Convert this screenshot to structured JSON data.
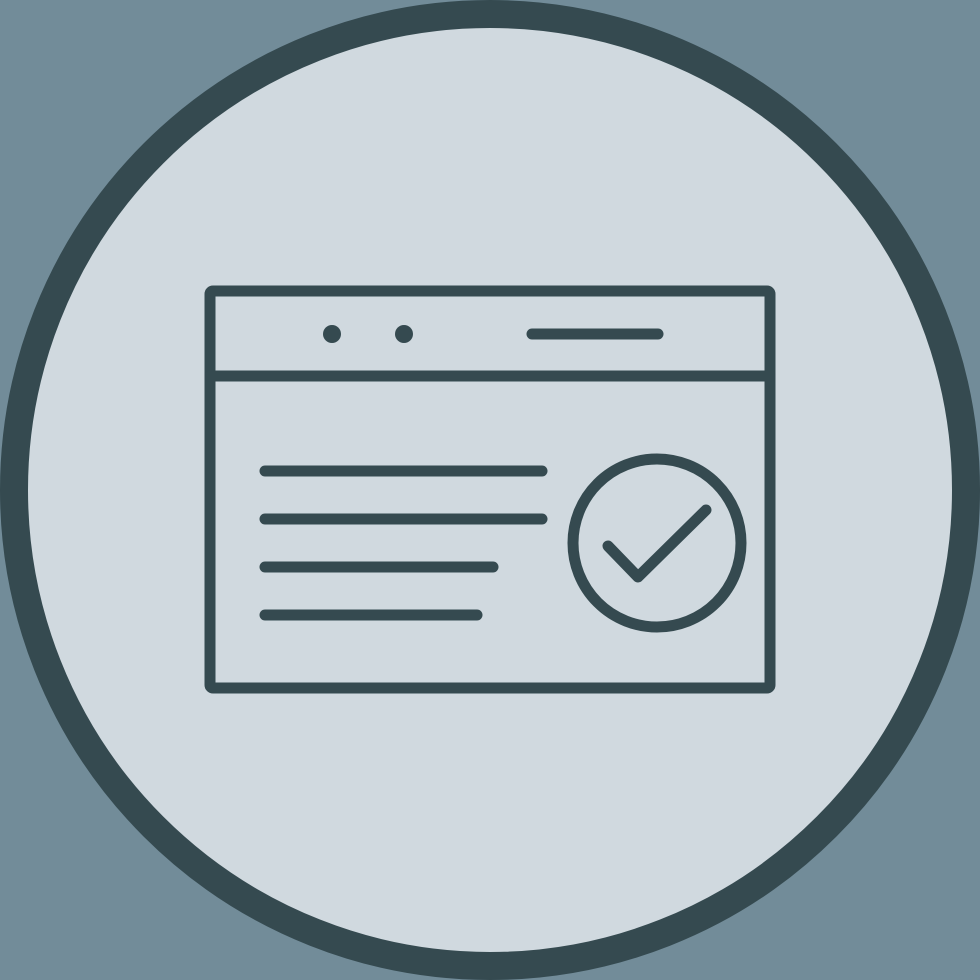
{
  "icon": {
    "name": "browser-window-verified-icon",
    "colors": {
      "background": "#728c99",
      "badge_fill": "#d0d9df",
      "stroke": "#354a50"
    },
    "elements": [
      "circle-badge",
      "browser-window",
      "title-bar-dot",
      "title-bar-dot",
      "address-bar-line",
      "text-line",
      "text-line",
      "text-line",
      "text-line",
      "check-circle-icon"
    ]
  }
}
